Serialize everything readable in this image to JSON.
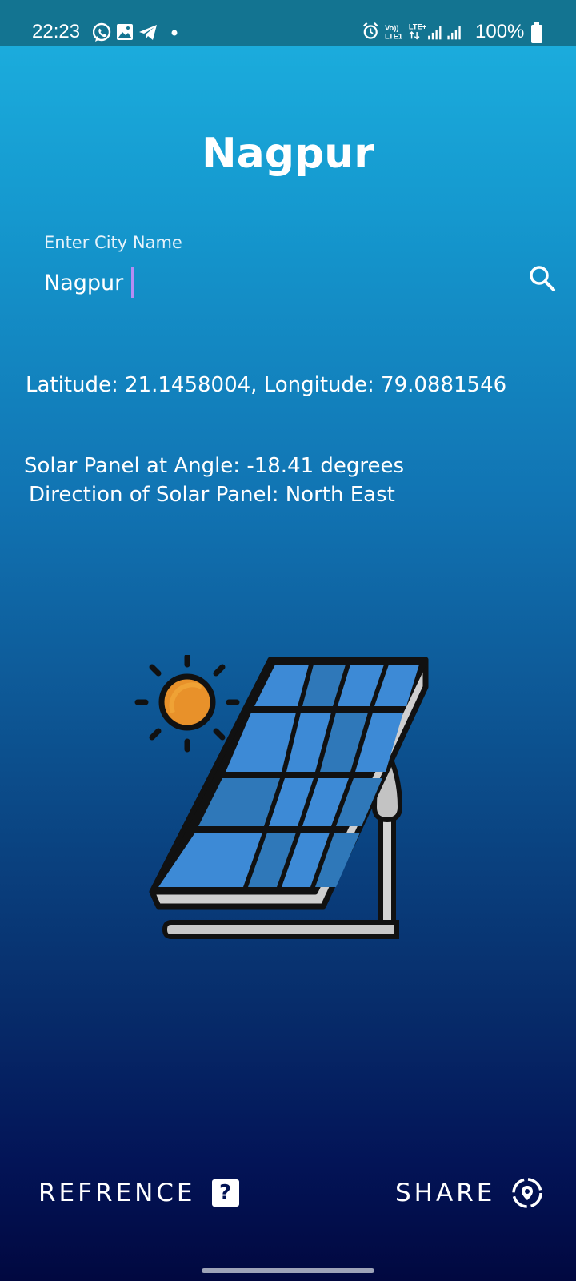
{
  "status_bar": {
    "time": "22:23",
    "battery_text": "100%",
    "left_icons": [
      "whatsapp-icon",
      "gallery-icon",
      "telegram-icon",
      "notification-dot-icon"
    ],
    "right_icons": [
      "alarm-icon",
      "volte-lte-icon",
      "signal-1-icon",
      "signal-2-icon",
      "battery-icon"
    ],
    "network_label_top": "Vo))",
    "network_label_bottom": "LTE1",
    "lte_label": "LTE+"
  },
  "header": {
    "city_title": "Nagpur"
  },
  "search": {
    "label": "Enter City Name",
    "value": "Nagpur",
    "icon": "search-icon"
  },
  "results": {
    "coordinates": "Latitude: 21.1458004, Longitude: 79.0881546",
    "angle": "Solar Panel at Angle: -18.41 degrees",
    "direction": "Direction of Solar Panel: North East"
  },
  "illustration": {
    "icon": "solar-panel-sun-icon"
  },
  "bottom_actions": {
    "reference_label": "REFRENCE",
    "reference_badge": "?",
    "share_label": "SHARE",
    "share_icon": "location-share-icon"
  },
  "colors": {
    "status_bar": "#137491",
    "gradient_top": "#1db1e0",
    "gradient_bottom": "#010840",
    "cursor": "#b68cf3",
    "sun": "#e8912a",
    "panel_cell_light": "#3d8ad6",
    "panel_cell_dark": "#2f78b9"
  }
}
